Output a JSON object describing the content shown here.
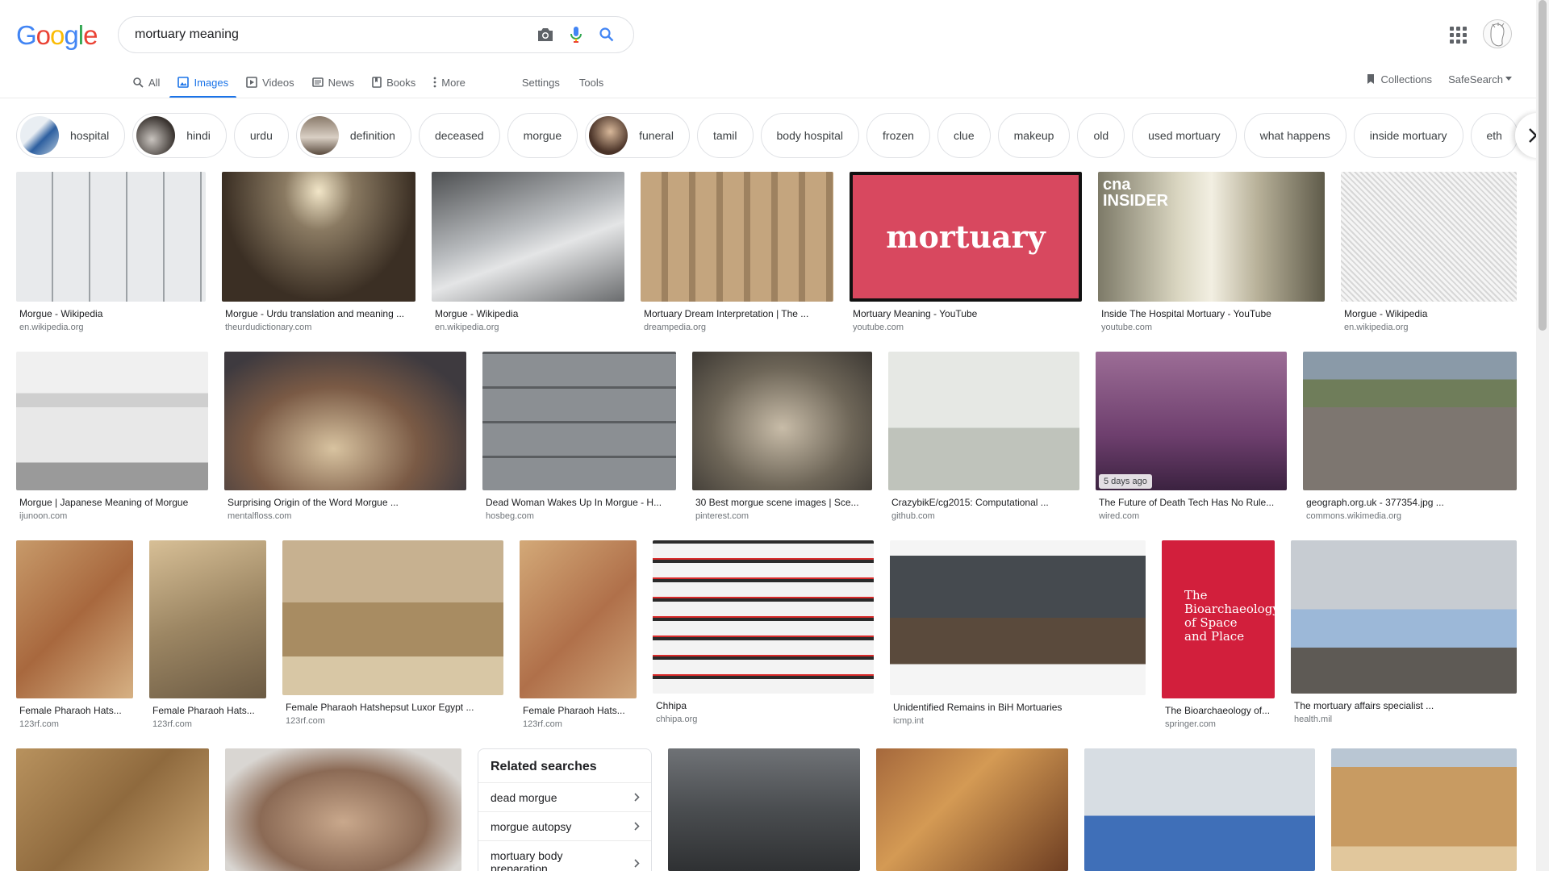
{
  "logo": [
    "G",
    "o",
    "o",
    "g",
    "l",
    "e"
  ],
  "search": {
    "query": "mortuary meaning"
  },
  "tabs": {
    "all": "All",
    "images": "Images",
    "videos": "Videos",
    "news": "News",
    "books": "Books",
    "more": "More",
    "settings": "Settings",
    "tools": "Tools"
  },
  "right_tools": {
    "collections": "Collections",
    "safesearch": "SafeSearch"
  },
  "chips": [
    "hospital",
    "hindi",
    "urdu",
    "definition",
    "deceased",
    "morgue",
    "funeral",
    "tamil",
    "body hospital",
    "frozen",
    "clue",
    "makeup",
    "old",
    "used mortuary",
    "what happens",
    "inside mortuary",
    "eth"
  ],
  "results": [
    {
      "caption": "Morgue - Wikipedia",
      "source": "en.wikipedia.org"
    },
    {
      "caption": "Morgue - Urdu translation and meaning ...",
      "source": "theurdudictionary.com"
    },
    {
      "caption": "Morgue - Wikipedia",
      "source": "en.wikipedia.org"
    },
    {
      "caption": "Mortuary Dream Interpretation | The ...",
      "source": "dreampedia.org"
    },
    {
      "caption": "Mortuary Meaning - YouTube",
      "source": "youtube.com",
      "image_text": "mortuary"
    },
    {
      "caption": "Inside The Hospital Mortuary - YouTube",
      "source": "youtube.com",
      "image_text": "cna INSIDER"
    },
    {
      "caption": "Morgue - Wikipedia",
      "source": "en.wikipedia.org"
    },
    {
      "caption": "Morgue | Japanese Meaning of Morgue",
      "source": "ijunoon.com"
    },
    {
      "caption": "Surprising Origin of the Word Morgue ...",
      "source": "mentalfloss.com"
    },
    {
      "caption": "Dead Woman Wakes Up In Morgue - H...",
      "source": "hosbeg.com"
    },
    {
      "caption": "30 Best morgue scene images | Sce...",
      "source": "pinterest.com"
    },
    {
      "caption": "CrazybikE/cg2015: Computational ...",
      "source": "github.com"
    },
    {
      "caption": "The Future of Death Tech Has No Rule...",
      "source": "wired.com",
      "badge": "5 days ago"
    },
    {
      "caption": "geograph.org.uk - 377354.jpg ...",
      "source": "commons.wikimedia.org"
    },
    {
      "caption": "Female Pharaoh Hats...",
      "source": "123rf.com"
    },
    {
      "caption": "Female Pharaoh Hats...",
      "source": "123rf.com"
    },
    {
      "caption": "Female Pharaoh Hatshepsut Luxor Egypt ...",
      "source": "123rf.com"
    },
    {
      "caption": "Female Pharaoh Hats...",
      "source": "123rf.com"
    },
    {
      "caption": "Chhipa",
      "source": "chhipa.org"
    },
    {
      "caption": "Unidentified Remains in BiH Mortuaries",
      "source": "icmp.int"
    },
    {
      "caption": "The Bioarchaeology of...",
      "source": "springer.com",
      "image_text": "The Bioarchaeology of Space and Place"
    },
    {
      "caption": "The mortuary affairs specialist ...",
      "source": "health.mil"
    }
  ],
  "related": {
    "title": "Related searches",
    "items": [
      "dead morgue",
      "morgue autopsy",
      "mortuary body preparation"
    ]
  }
}
